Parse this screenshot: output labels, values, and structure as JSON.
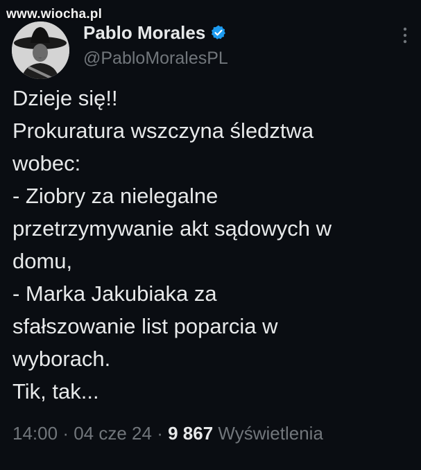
{
  "watermark": "www.wiocha.pl",
  "author": {
    "display_name": "Pablo Morales",
    "handle": "@PabloMoralesPL",
    "verified": true,
    "verified_icon": "verified-badge-icon",
    "avatar_icon": "avatar-portrait"
  },
  "menu_icon": "more-options-icon",
  "tweet": {
    "lines": [
      "Dzieje się!!",
      "Prokuratura wszczyna śledztwa",
      "wobec:",
      "- Ziobry za nielegalne",
      "przetrzymywanie akt sądowych w",
      "domu,",
      "- Marka Jakubiaka za",
      "sfałszowanie list poparcia w",
      "wyborach.",
      "Tik, tak..."
    ]
  },
  "meta": {
    "time": "14:00",
    "separator": "·",
    "date": "04 cze 24",
    "views_count": "9 867",
    "views_label": "Wyświetlenia"
  },
  "colors": {
    "background": "#0a0d12",
    "text": "#e7e9ea",
    "secondary": "#71767b",
    "verified": "#1d9bf0"
  }
}
